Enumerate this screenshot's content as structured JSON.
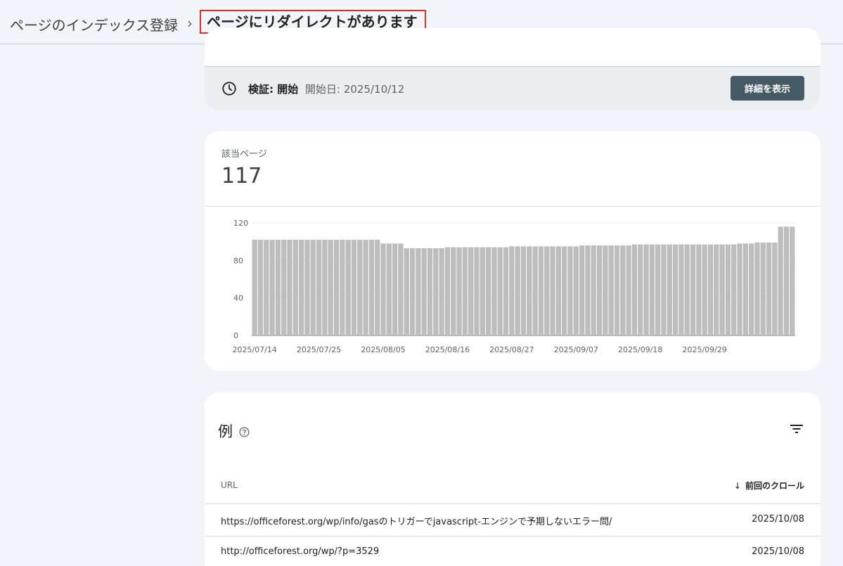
{
  "breadcrumb": {
    "parent": "ページのインデックス登録",
    "separator": "›",
    "current": "ページにリダイレクトがあります"
  },
  "validation": {
    "icon": "clock-icon",
    "label": "検証: 開始",
    "date_text": "開始日: 2025/10/12",
    "button_label": "詳細を表示"
  },
  "metric": {
    "label": "該当ページ",
    "value": "117"
  },
  "chart_data": {
    "type": "bar",
    "title": "",
    "xlabel": "",
    "ylabel": "",
    "ylim": [
      0,
      120
    ],
    "y_ticks": [
      0,
      40,
      80,
      120
    ],
    "x_tick_labels": [
      "2025/07/14",
      "2025/07/25",
      "2025/08/05",
      "2025/08/16",
      "2025/08/27",
      "2025/09/07",
      "2025/09/18",
      "2025/09/29"
    ],
    "x_start": "2025/07/14",
    "values": [
      102,
      102,
      102,
      102,
      102,
      102,
      102,
      102,
      102,
      102,
      102,
      102,
      102,
      102,
      102,
      102,
      102,
      102,
      102,
      102,
      102,
      102,
      98,
      98,
      98,
      98,
      93,
      93,
      93,
      93,
      93,
      93,
      93,
      94,
      94,
      94,
      94,
      94,
      94,
      94,
      94,
      94,
      94,
      94,
      95,
      95,
      95,
      95,
      95,
      95,
      95,
      95,
      95,
      95,
      95,
      95,
      96,
      96,
      96,
      96,
      96,
      96,
      96,
      96,
      96,
      97,
      97,
      97,
      97,
      97,
      97,
      97,
      97,
      97,
      97,
      97,
      97,
      97,
      97,
      97,
      97,
      97,
      97,
      98,
      98,
      98,
      99,
      99,
      99,
      99,
      116,
      116,
      116
    ],
    "bar_color": "#bdbdbd",
    "grid": true
  },
  "examples": {
    "title": "例",
    "help_icon": "help-circle-icon",
    "filter_icon": "filter-icon",
    "columns": {
      "url": "URL",
      "last_crawl": "前回のクロール",
      "sort_arrow": "↓"
    },
    "rows": [
      {
        "url": "https://officeforest.org/wp/info/gasのトリガーでjavascript-エンジンで予期しないエラー問/",
        "date": "2025/10/08"
      },
      {
        "url": "http://officeforest.org/wp/?p=3529",
        "date": "2025/10/08"
      }
    ]
  }
}
